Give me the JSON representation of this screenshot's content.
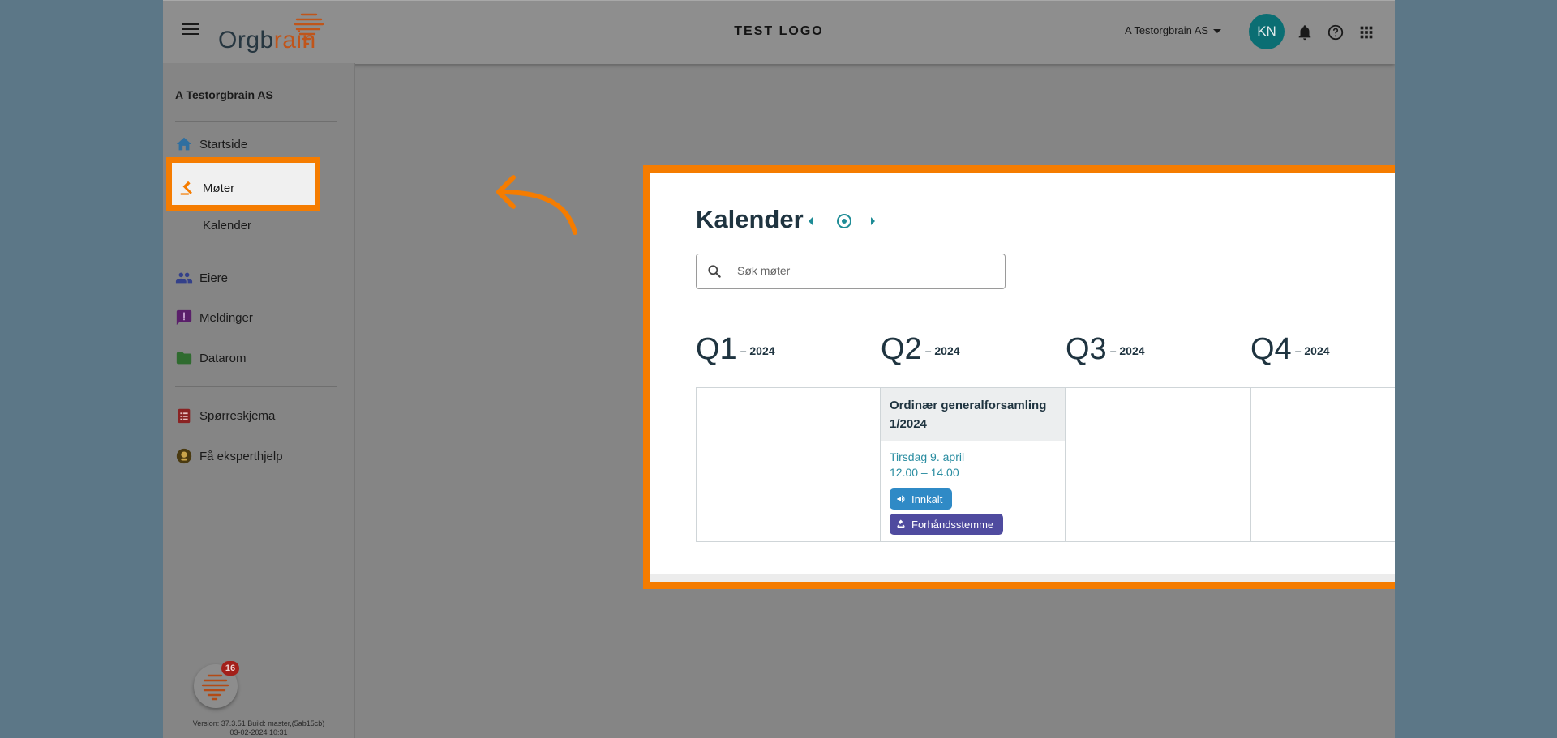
{
  "header": {
    "logo_text_main": "Orgb",
    "logo_text_accent": "rain",
    "title": "TEST LOGO",
    "org_switch": "A Testorgbrain AS",
    "avatar_initials": "KN"
  },
  "sidebar": {
    "company": "A Testorgbrain AS",
    "items": {
      "startside": "Startside",
      "moter": "Møter",
      "kalender": "Kalender",
      "eiere": "Eiere",
      "meldinger": "Meldinger",
      "datarom": "Datarom",
      "sporreskjema": "Spørreskjema",
      "ekspert": "Få eksperthjelp"
    },
    "notification_count": "16",
    "version_line1": "Version: 37.3.51 Build: master,(5ab15cb)",
    "version_line2": "03-02-2024 10:31"
  },
  "calendar": {
    "title": "Kalender",
    "search_placeholder": "Søk møter",
    "quarters": [
      {
        "label": "Q1",
        "year": "– 2024"
      },
      {
        "label": "Q2",
        "year": "– 2024"
      },
      {
        "label": "Q3",
        "year": "– 2024"
      },
      {
        "label": "Q4",
        "year": "– 2024"
      }
    ],
    "event": {
      "title": "Ordinær generalforsamling 1/2024",
      "date": "Tirsdag 9. april",
      "time": "12.00 – 14.00",
      "status_chip": "Innkalt",
      "vote_chip": "Forhåndsstemme"
    }
  },
  "colors": {
    "highlight": "#f57c00",
    "teal": "#0b6e73",
    "innkalt_chip": "#2f8ac6",
    "forhand_chip": "#4f4b9f",
    "date_text": "#2a8da1"
  }
}
